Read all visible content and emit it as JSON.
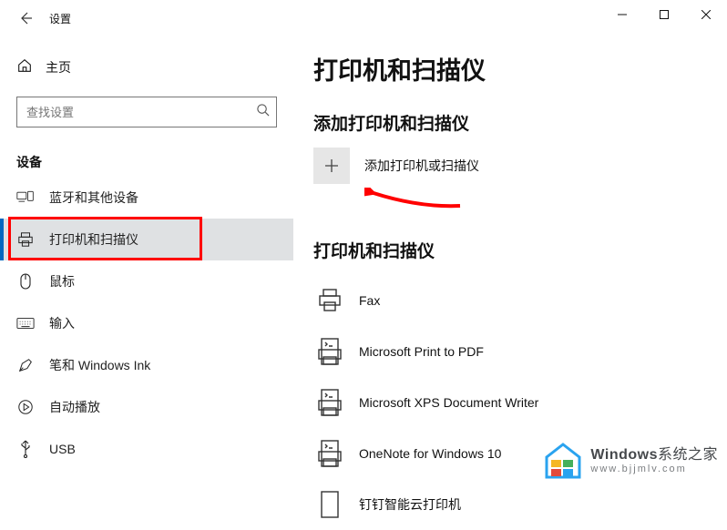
{
  "window": {
    "title": "设置"
  },
  "sidebar": {
    "home_label": "主页",
    "search_placeholder": "查找设置",
    "group_label": "设备",
    "items": [
      {
        "label": "蓝牙和其他设备"
      },
      {
        "label": "打印机和扫描仪"
      },
      {
        "label": "鼠标"
      },
      {
        "label": "输入"
      },
      {
        "label": "笔和 Windows Ink"
      },
      {
        "label": "自动播放"
      },
      {
        "label": "USB"
      }
    ]
  },
  "content": {
    "page_title": "打印机和扫描仪",
    "add_section_header": "添加打印机和扫描仪",
    "add_button_label": "添加打印机或扫描仪",
    "list_section_header": "打印机和扫描仪",
    "printers": [
      {
        "name": "Fax"
      },
      {
        "name": "Microsoft Print to PDF"
      },
      {
        "name": "Microsoft XPS Document Writer"
      },
      {
        "name": "OneNote for Windows 10"
      },
      {
        "name": "钉钉智能云打印机"
      }
    ]
  },
  "watermark": {
    "line1a": "Windows",
    "line1b": "系统之家",
    "line2": "www.bjjmlv.com"
  }
}
